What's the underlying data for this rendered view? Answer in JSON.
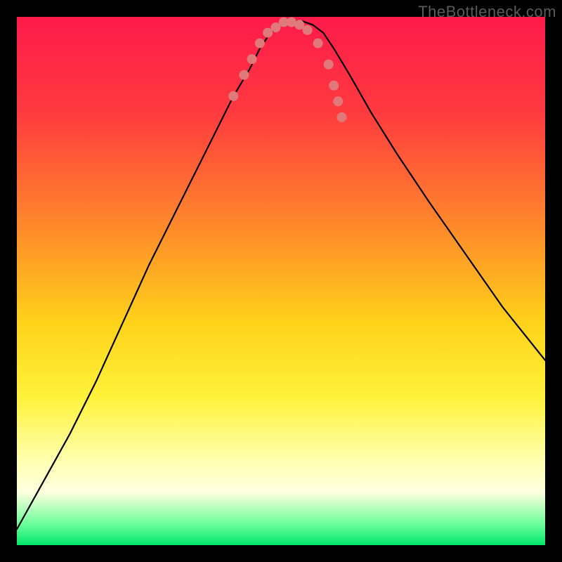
{
  "watermark": "TheBottleneck.com",
  "chart_data": {
    "type": "line",
    "title": "",
    "xlabel": "",
    "ylabel": "",
    "xlim": [
      0,
      100
    ],
    "ylim": [
      0,
      100
    ],
    "background_gradient": {
      "stops": [
        {
          "offset": 0.0,
          "color": "#ff1a4b"
        },
        {
          "offset": 0.18,
          "color": "#ff3a3f"
        },
        {
          "offset": 0.4,
          "color": "#ff8a2a"
        },
        {
          "offset": 0.58,
          "color": "#ffd21a"
        },
        {
          "offset": 0.72,
          "color": "#fff23a"
        },
        {
          "offset": 0.84,
          "color": "#ffffb0"
        },
        {
          "offset": 0.9,
          "color": "#ffffe0"
        },
        {
          "offset": 0.96,
          "color": "#6cff9a"
        },
        {
          "offset": 1.0,
          "color": "#00e66d"
        }
      ]
    },
    "series": [
      {
        "name": "bottleneck-curve",
        "stroke": "#000000",
        "stroke_width": 2.2,
        "x": [
          0,
          5,
          10,
          15,
          20,
          25,
          30,
          34,
          38,
          41,
          44,
          46,
          48,
          50,
          52,
          54,
          56,
          58,
          60,
          63,
          67,
          72,
          78,
          85,
          92,
          100
        ],
        "y": [
          3,
          12,
          21,
          31,
          42,
          53,
          63,
          71,
          79,
          85,
          90,
          94,
          97,
          98.5,
          99.2,
          99.2,
          98.5,
          97,
          94,
          89,
          82,
          74,
          65,
          55,
          45,
          35
        ]
      }
    ],
    "scatter": {
      "name": "sample-points",
      "color": "#e07a7a",
      "radius": 7,
      "x": [
        41,
        43,
        44.5,
        46,
        47.5,
        49,
        50.5,
        52,
        53.5,
        55,
        57,
        59,
        60,
        60.8,
        61.5
      ],
      "y": [
        85,
        89,
        92,
        95,
        97,
        98,
        99,
        99,
        98.5,
        97.5,
        95,
        91,
        87,
        84,
        81
      ]
    }
  }
}
